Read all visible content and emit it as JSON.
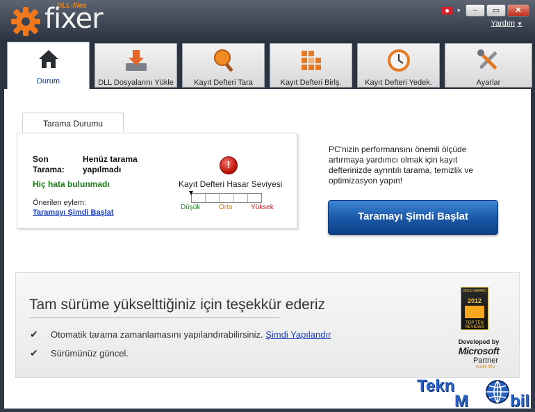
{
  "app": {
    "brand_top": "DLL-files",
    "brand_name": "fixer",
    "help_label": "Yardım"
  },
  "window_controls": {
    "minimize": "‒",
    "maximize": "▭",
    "close": "✕"
  },
  "tabs": [
    {
      "label": "Durum",
      "icon": "home-icon",
      "active": true
    },
    {
      "label": "DLL Dosyalarını Yükle",
      "icon": "download-icon",
      "active": false
    },
    {
      "label": "Kayıt Defteri Tara",
      "icon": "magnifier-icon",
      "active": false
    },
    {
      "label": "Kayıt Defteri Birlş.",
      "icon": "blocks-icon",
      "active": false
    },
    {
      "label": "Kayıt Defteri Yedek.",
      "icon": "clock-icon",
      "active": false
    },
    {
      "label": "Ayarlar",
      "icon": "tools-icon",
      "active": false
    }
  ],
  "scan_status": {
    "tab_label": "Tarama Durumu",
    "last_scan_label": "Son Tarama:",
    "last_scan_label_1": "Son",
    "last_scan_label_2": "Tarama:",
    "last_scan_value_1": "Henüz tarama",
    "last_scan_value_2": "yapılmadı",
    "no_errors": "Hiç hata bulunmadı",
    "suggested_label": "Önerilen eylem:",
    "suggested_link": "Taramayı Şimdi Başlat",
    "error_icon_glyph": "!",
    "damage_title": "Kayıt Defteri Hasar Seviyesi",
    "damage_low": "Düşük",
    "damage_mid": "Orta",
    "damage_high": "Yüksek",
    "damage_level": 0
  },
  "right": {
    "info_text": "PC'nizin performansını önemli ölçüde artırmaya yardımcı olmak için kayıt defterinizde ayrıntılı tarama, temizlik ve optimizasyon yapın!",
    "scan_button": "Taramayı Şimdi Başlat"
  },
  "upgrade": {
    "title": "Tam sürüme yükselttiğiniz için teşekkür ederiz",
    "features": [
      {
        "text": "Otomatik tarama zamanlamasını yapılandırabilirsiniz.",
        "link": "Şimdi Yapılandır"
      },
      {
        "text": "Sürümünüz güncel.",
        "link": ""
      }
    ],
    "award": {
      "gold": "GOLD AWARD",
      "year": "2012",
      "reviews": "TOP TEN REVIEWS"
    },
    "partner": {
      "developed_by": "Developed by",
      "company": "Microsoft",
      "partner": "Partner",
      "tier": "Gold ISV"
    }
  },
  "watermark": {
    "text_1": "Tekn",
    "text_2": "M",
    "text_3": "bil"
  },
  "colors": {
    "accent_orange": "#f28a1c",
    "link_blue": "#1a3fbf",
    "ok_green": "#1b7a1b",
    "button_blue": "#1b5aa8"
  }
}
